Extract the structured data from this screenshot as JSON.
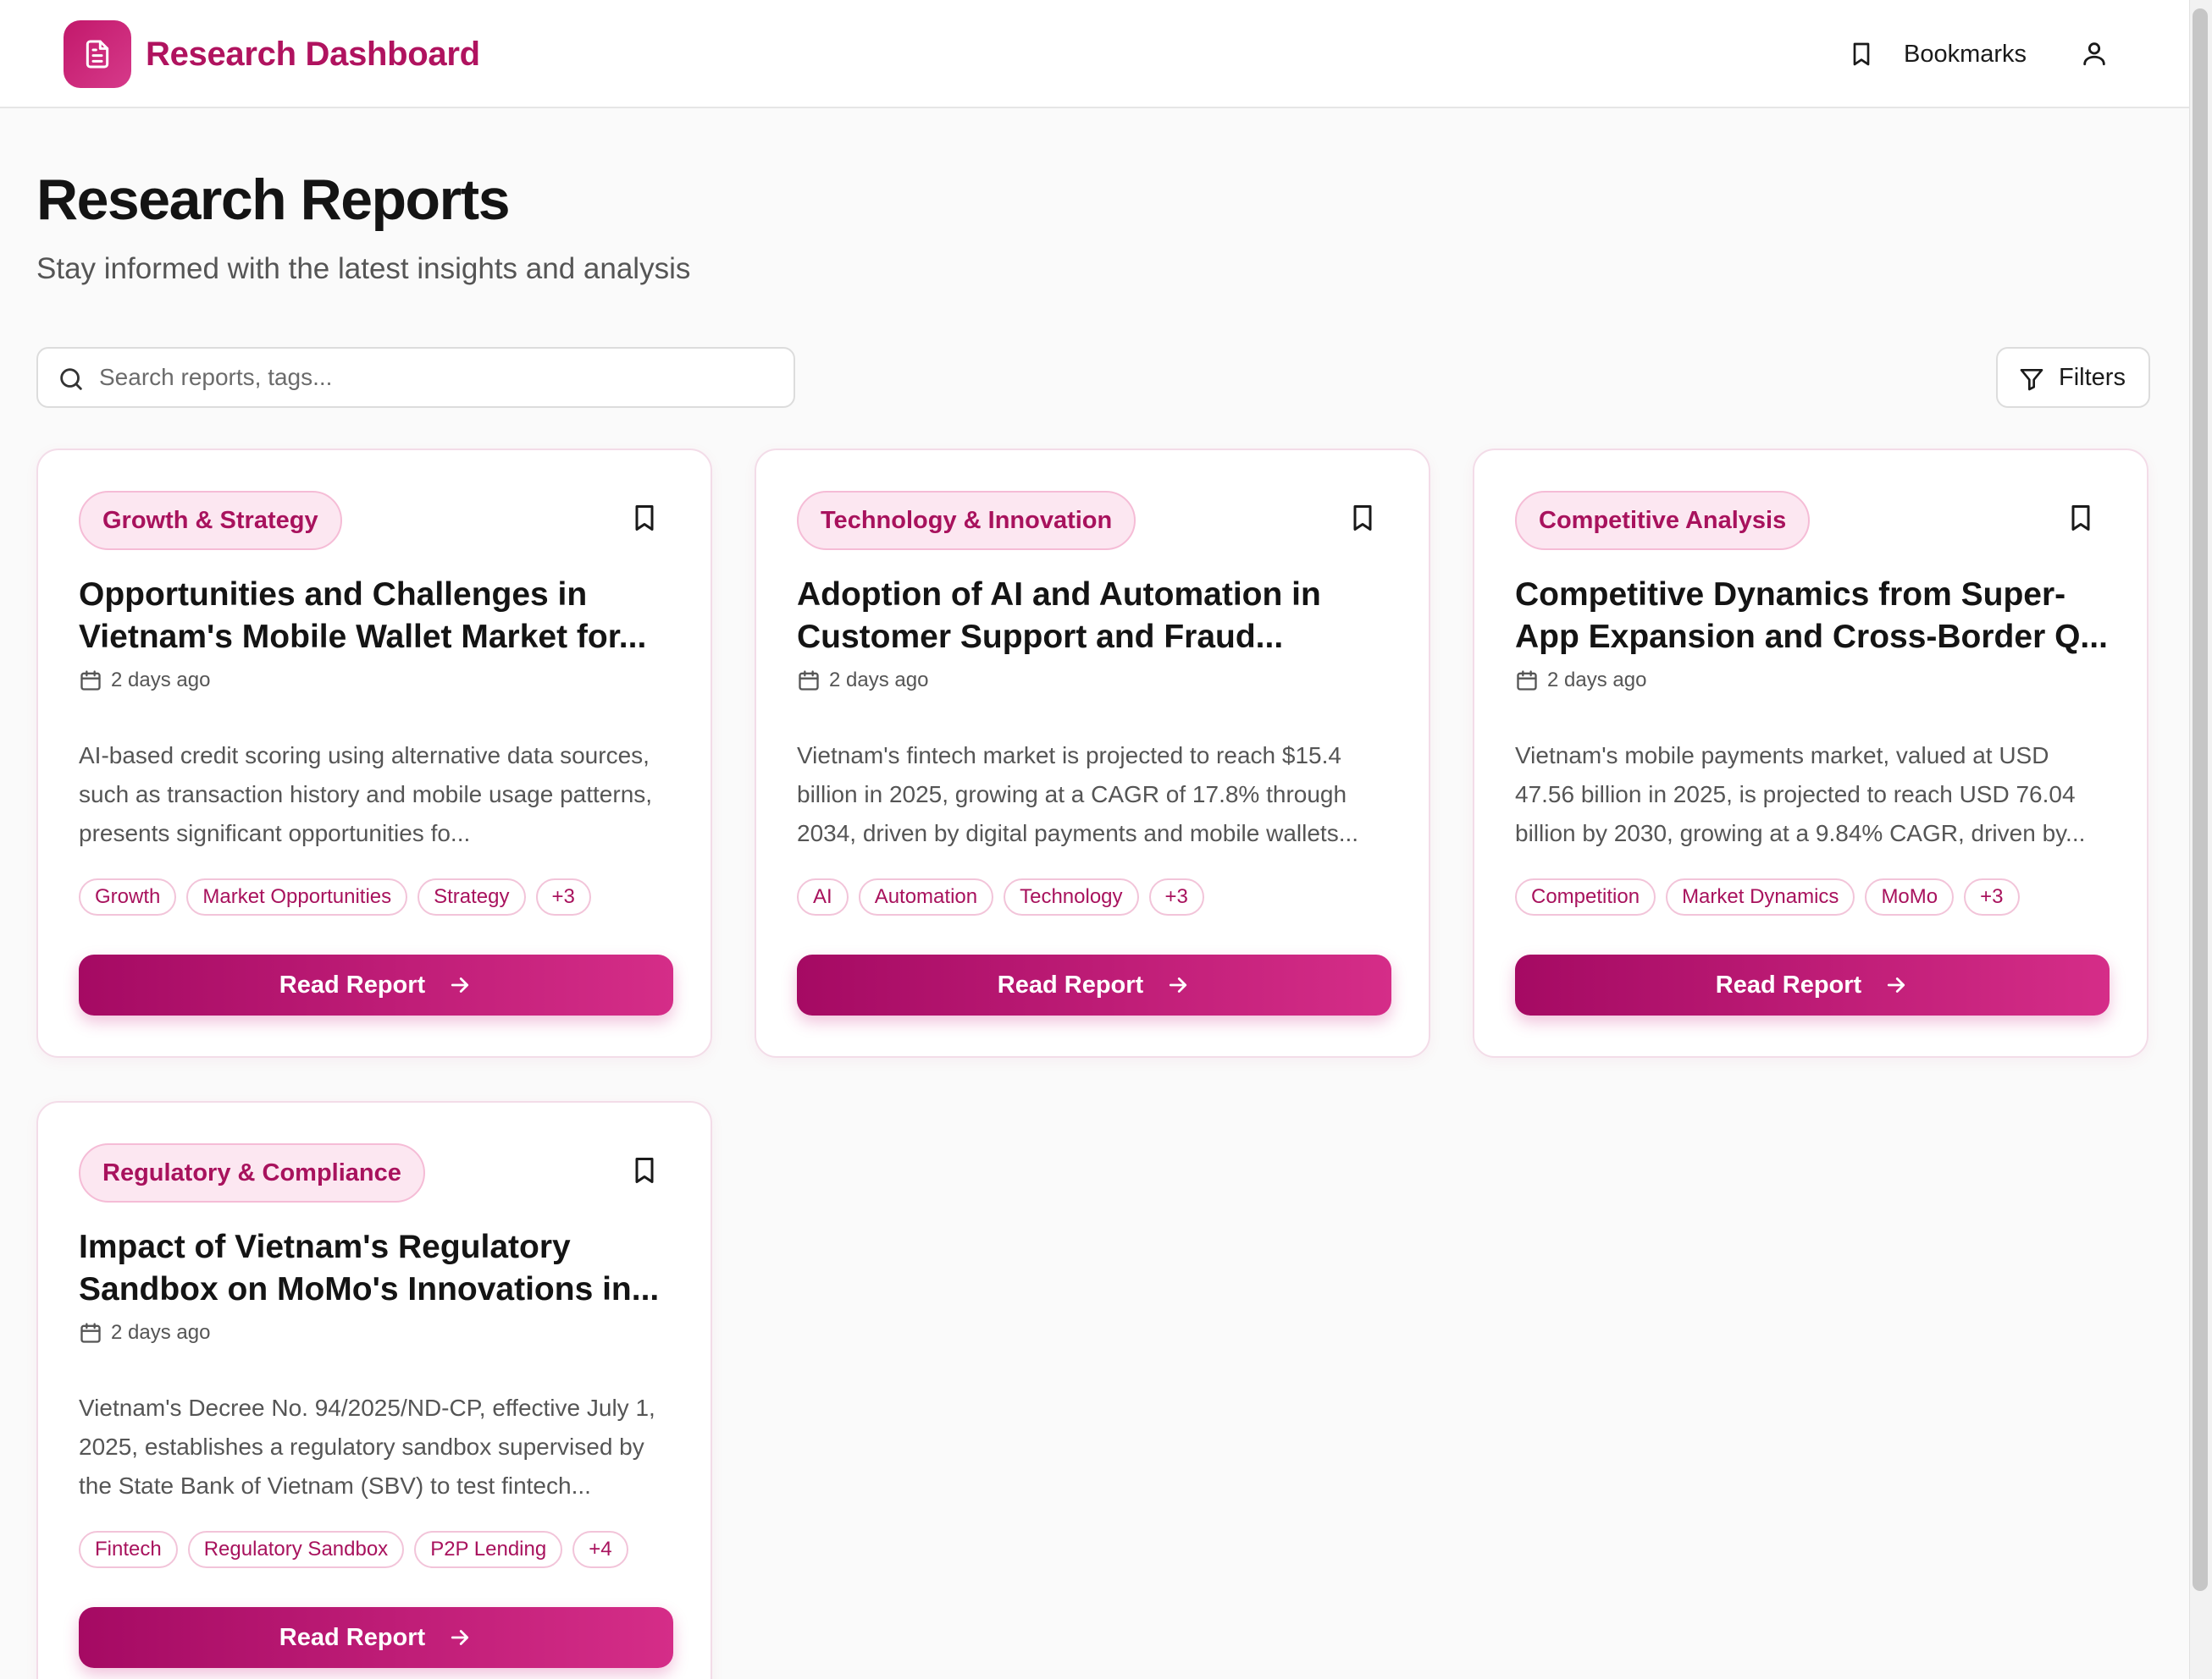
{
  "header": {
    "brand": "Research Dashboard",
    "brand_icon": "document-icon",
    "bookmarks_label": "Bookmarks",
    "bookmarks_icon": "bookmark-icon",
    "user_icon": "user-icon"
  },
  "page": {
    "title": "Research Reports",
    "subtitle": "Stay informed with the latest insights and analysis"
  },
  "search": {
    "placeholder": "Search reports, tags...",
    "value": ""
  },
  "filters": {
    "label": "Filters"
  },
  "colors": {
    "accent": "#b0135f",
    "accent_light": "#fce7f1",
    "button_gradient_start": "#a50a63",
    "button_gradient_end": "#d52d88"
  },
  "cards": [
    {
      "category": "Growth & Strategy",
      "title": "Opportunities and Challenges in Vietnam's Mobile Wallet Market for...",
      "date": "2 days ago",
      "summary": "AI-based credit scoring using alternative data sources, such as transaction history and mobile usage patterns, presents significant opportunities fo...",
      "tags": [
        "Growth",
        "Market Opportunities",
        "Strategy",
        "+3"
      ],
      "button": "Read Report"
    },
    {
      "category": "Technology & Innovation",
      "title": "Adoption of AI and Automation in Customer Support and Fraud...",
      "date": "2 days ago",
      "summary": "Vietnam's fintech market is projected to reach $15.4 billion in 2025, growing at a CAGR of 17.8% through 2034, driven by digital payments and mobile wallets...",
      "tags": [
        "AI",
        "Automation",
        "Technology",
        "+3"
      ],
      "button": "Read Report"
    },
    {
      "category": "Competitive Analysis",
      "title": "Competitive Dynamics from Super-App Expansion and Cross-Border Q...",
      "date": "2 days ago",
      "summary": "Vietnam's mobile payments market, valued at USD 47.56 billion in 2025, is projected to reach USD 76.04 billion by 2030, growing at a 9.84% CAGR, driven by...",
      "tags": [
        "Competition",
        "Market Dynamics",
        "MoMo",
        "+3"
      ],
      "button": "Read Report"
    },
    {
      "category": "Regulatory & Compliance",
      "title": "Impact of Vietnam's Regulatory Sandbox on MoMo's Innovations in...",
      "date": "2 days ago",
      "summary": "Vietnam's Decree No. 94/2025/ND-CP, effective July 1, 2025, establishes a regulatory sandbox supervised by the State Bank of Vietnam (SBV) to test fintech...",
      "tags": [
        "Fintech",
        "Regulatory Sandbox",
        "P2P Lending",
        "+4"
      ],
      "button": "Read Report"
    }
  ]
}
